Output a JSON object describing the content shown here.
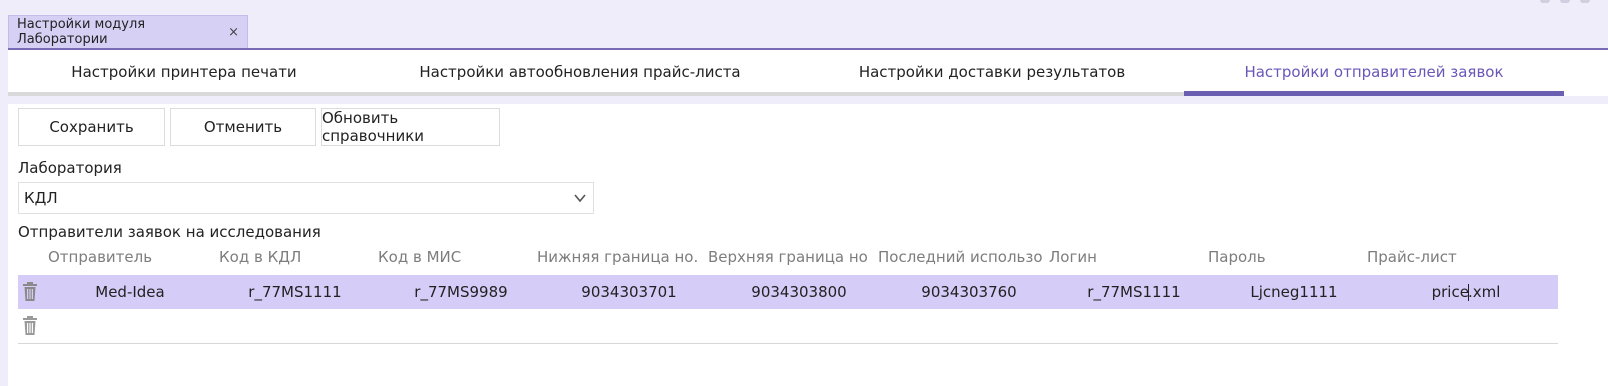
{
  "doc_tab": {
    "title": "Настройки модуля Лаборатории",
    "close": "×"
  },
  "settings_tabs": [
    {
      "label": "Настройки принтера печати"
    },
    {
      "label": "Настройки автообновления прайс-листа"
    },
    {
      "label": "Настройки доставки результатов"
    },
    {
      "label": "Настройки отправителей заявок"
    }
  ],
  "active_tab": 3,
  "toolbar": {
    "save_label": "Сохранить",
    "cancel_label": "Отменить",
    "refresh_label": "Обновить справочники"
  },
  "laboratory": {
    "label": "Лаборатория",
    "value": "КДЛ"
  },
  "senders": {
    "label": "Отправители заявок на исследования",
    "columns": [
      "Отправитель",
      "Код в КДЛ",
      "Код в МИС",
      "Нижняя граница но...",
      "Верхняя граница но...",
      "Последний использо...",
      "Логин",
      "Пароль",
      "Прайс-лист"
    ],
    "rows": [
      {
        "sender": "Med-Idea",
        "code_kdl": "r_77MS1111",
        "code_mis": "r_77MS9989",
        "lower": "9034303701",
        "upper": "9034303800",
        "last_used": "9034303760",
        "login": "r_77MS1111",
        "password": "Ljcneg1111",
        "price_list_a": "price",
        "price_list_b": ".xml"
      }
    ]
  },
  "colors": {
    "accent": "#6a57b8",
    "selected_row": "#d5cdf8",
    "background": "#efedfa"
  },
  "icons": [
    "close-icon",
    "chevron-down-icon",
    "trash-icon"
  ]
}
